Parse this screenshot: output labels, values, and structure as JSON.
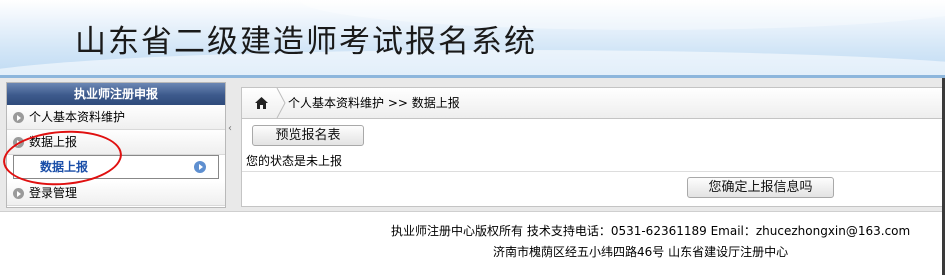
{
  "header": {
    "title": "山东省二级建造师考试报名系统"
  },
  "sidebar": {
    "heading": "执业师注册申报",
    "items": [
      {
        "label": "个人基本资料维护"
      },
      {
        "label": "数据上报"
      },
      {
        "label": "登录管理"
      }
    ],
    "sub_item": {
      "label": "数据上报"
    }
  },
  "breadcrumb": {
    "path": "个人基本资料维护 >> 数据上报"
  },
  "content": {
    "preview_button": "预览报名表",
    "status_text": "您的状态是未上报",
    "confirm_button": "您确定上报信息吗"
  },
  "footer": {
    "line1": "执业师注册中心版权所有 技术支持电话：0531-62361189 Email：zhucezhongxin@163.com",
    "line2": "济南市槐荫区经五小纬四路46号 山东省建设厅注册中心"
  },
  "icons": {
    "home": "home-icon",
    "bullet": "circle-arrow-icon",
    "collapse": "chevron-left-icon"
  },
  "colors": {
    "sidebar_header": "#3d5a8c",
    "active_link": "#1a4ea8",
    "annotation": "#e01010"
  }
}
